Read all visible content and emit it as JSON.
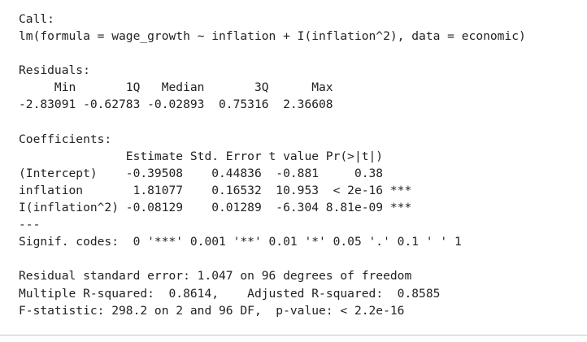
{
  "call": {
    "header": "Call:",
    "formula": "lm(formula = wage_growth ~ inflation + I(inflation^2), data = economic)"
  },
  "residuals": {
    "header": "Residuals:",
    "labels_line": "     Min       1Q   Median       3Q      Max ",
    "values_line": "-2.83091 -0.62783 -0.02893  0.75316  2.36608 "
  },
  "coefficients": {
    "header": "Coefficients:",
    "columns_line": "               Estimate Std. Error t value Pr(>|t|)    ",
    "rows": [
      "(Intercept)    -0.39508    0.44836  -0.881     0.38    ",
      "inflation       1.81077    0.16532  10.953  < 2e-16 ***",
      "I(inflation^2) -0.08129    0.01289  -6.304 8.81e-09 ***"
    ],
    "separator": "---",
    "signif_codes": "Signif. codes:  0 '***' 0.001 '**' 0.01 '*' 0.05 '.' 0.1 ' ' 1"
  },
  "summary": {
    "residual_se": "Residual standard error: 1.047 on 96 degrees of freedom",
    "r_squared": "Multiple R-squared:  0.8614,\tAdjusted R-squared:  0.8585 ",
    "f_statistic": "F-statistic: 298.2 on 2 and 96 DF,  p-value: < 2.2e-16"
  }
}
